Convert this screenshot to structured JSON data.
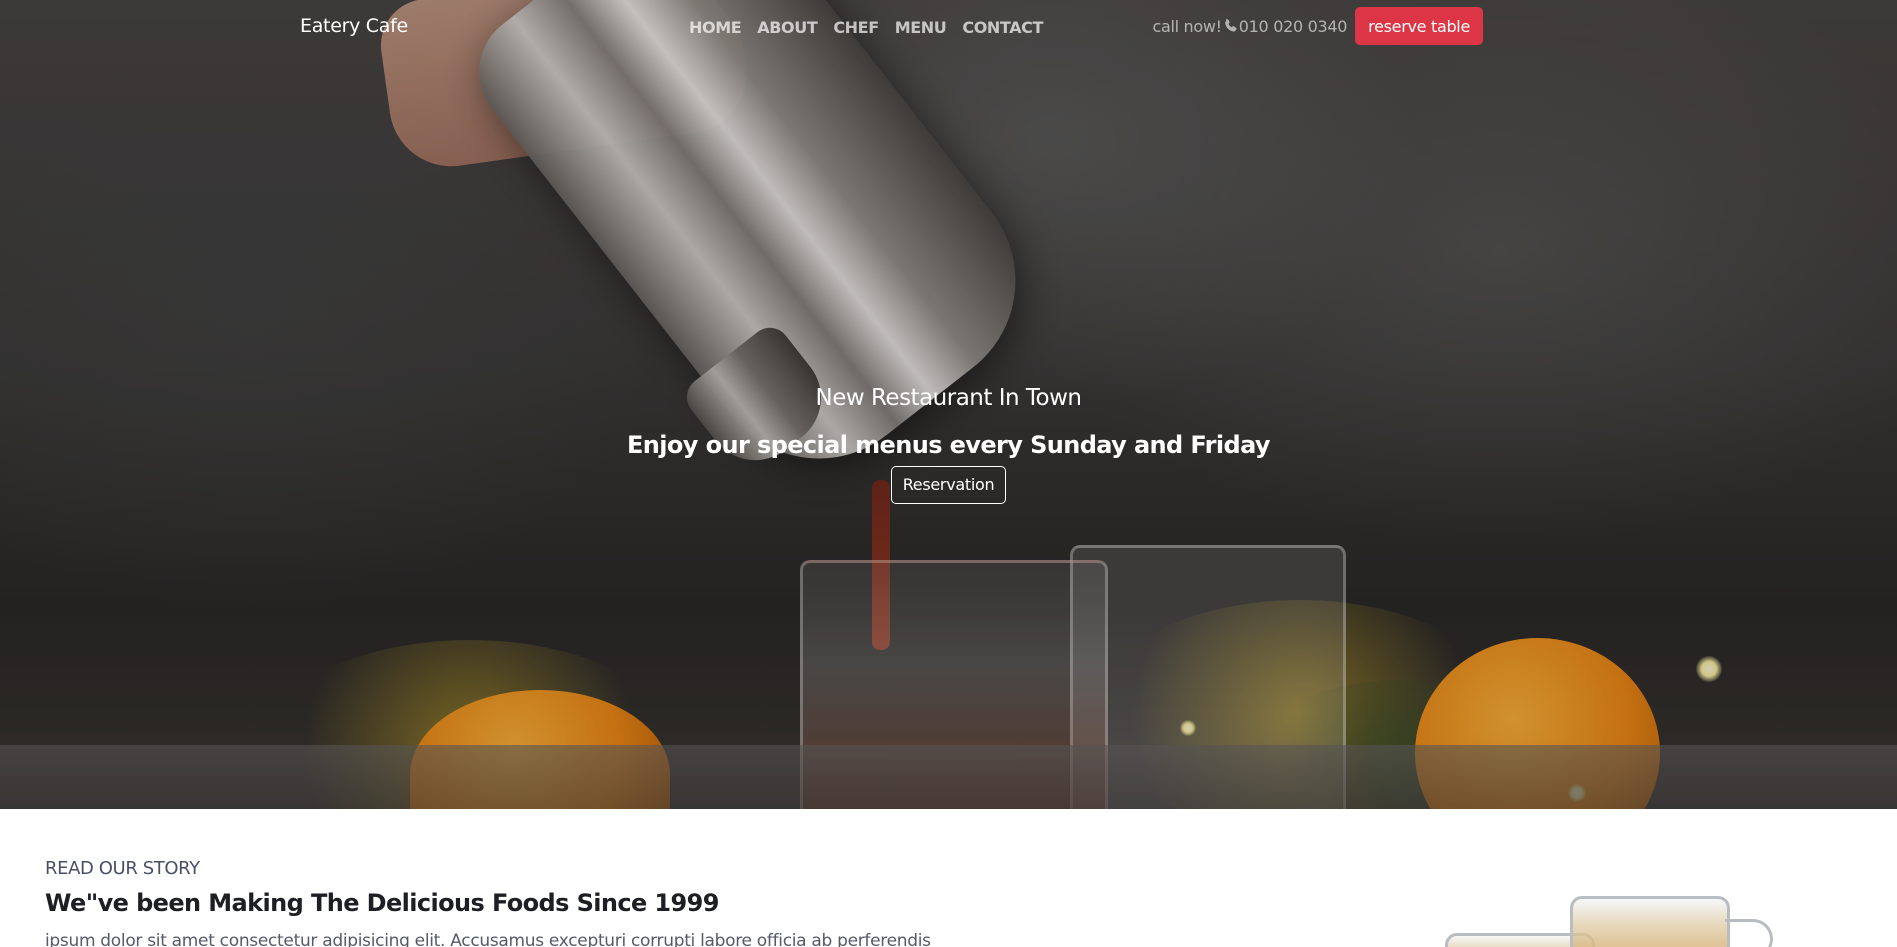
{
  "navbar": {
    "brand": "Eatery Cafe",
    "links": [
      "HOME",
      "ABOUT",
      "CHEF",
      "MENU",
      "CONTACT"
    ],
    "call_label": "call now!",
    "phone_icon": "phone-icon",
    "phone_number": "010 020 0340",
    "reserve_button": "reserve table"
  },
  "hero": {
    "subtitle": "New Restaurant In Town",
    "title": "Enjoy our special menus every Sunday and Friday",
    "button": "Reservation"
  },
  "story": {
    "kicker": "READ OUR STORY",
    "heading": "We\"ve been Making The Delicious Foods Since 1999",
    "body": "ipsum dolor sit amet consectetur adipisicing elit. Accusamus excepturi corrupti labore officia ab perferendis"
  },
  "colors": {
    "accent": "#dc3545",
    "hero_text": "#ffffff",
    "nav_text": "#b3b3b3",
    "story_heading": "#1d1f24"
  }
}
